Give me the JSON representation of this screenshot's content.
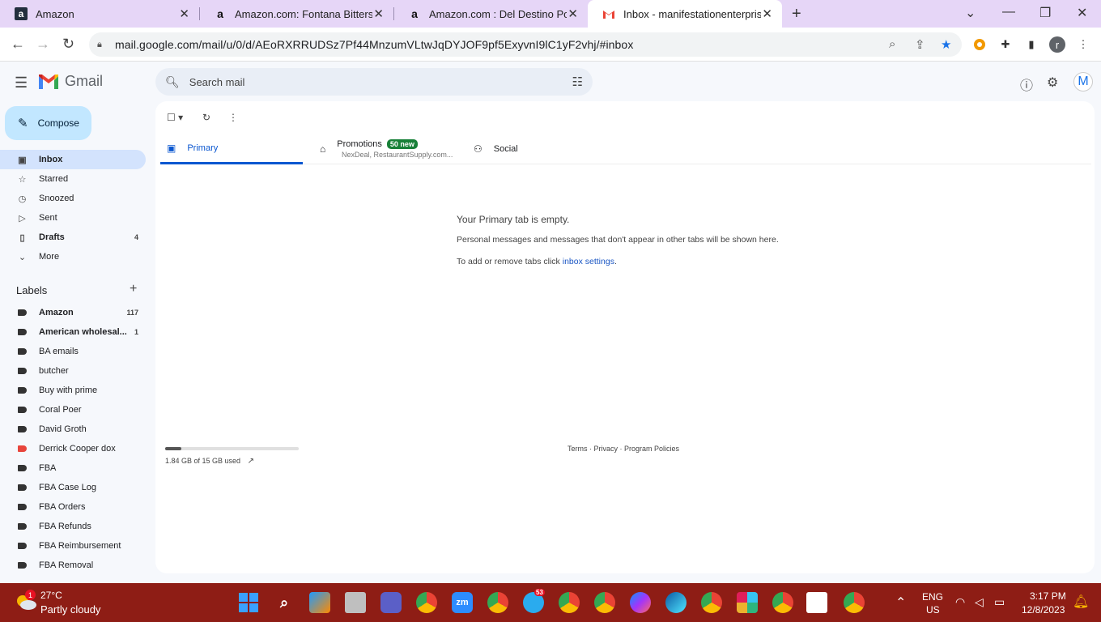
{
  "browser": {
    "tabs": [
      {
        "title": "Amazon"
      },
      {
        "title": "Amazon.com: Fontana Bitterswe"
      },
      {
        "title": "Amazon.com : Del Destino Pomo"
      },
      {
        "title": "Inbox - manifestationenterprises"
      }
    ],
    "url": "mail.google.com/mail/u/0/d/AEoRXRRUDSz7Pf44MnzumVLtwJqDYJOF9pf5ExyvnI9lC1yF2vhj/#inbox",
    "profile_initial": "r"
  },
  "gmail": {
    "app_name": "Gmail",
    "search_placeholder": "Search mail",
    "account_initial": "M",
    "compose_label": "Compose",
    "nav": [
      {
        "label": "Inbox",
        "count": ""
      },
      {
        "label": "Starred",
        "count": ""
      },
      {
        "label": "Snoozed",
        "count": ""
      },
      {
        "label": "Sent",
        "count": ""
      },
      {
        "label": "Drafts",
        "count": "4"
      },
      {
        "label": "More",
        "count": ""
      }
    ],
    "labels_heading": "Labels",
    "labels": [
      {
        "label": "Amazon",
        "count": "117",
        "color": "#333333"
      },
      {
        "label": "American wholesal...",
        "count": "1",
        "color": "#333333"
      },
      {
        "label": "BA emails",
        "count": "",
        "color": "#333333"
      },
      {
        "label": "butcher",
        "count": "",
        "color": "#333333"
      },
      {
        "label": "Buy with prime",
        "count": "",
        "color": "#333333"
      },
      {
        "label": "Coral Poer",
        "count": "",
        "color": "#333333"
      },
      {
        "label": "David Groth",
        "count": "",
        "color": "#333333"
      },
      {
        "label": "Derrick Cooper dox",
        "count": "",
        "color": "#e8453c"
      },
      {
        "label": "FBA",
        "count": "",
        "color": "#333333"
      },
      {
        "label": "FBA Case Log",
        "count": "",
        "color": "#333333"
      },
      {
        "label": "FBA Orders",
        "count": "",
        "color": "#333333"
      },
      {
        "label": "FBA Refunds",
        "count": "",
        "color": "#333333"
      },
      {
        "label": "FBA Reimbursement",
        "count": "",
        "color": "#333333"
      },
      {
        "label": "FBA Removal",
        "count": "",
        "color": "#333333"
      }
    ],
    "tabs": {
      "primary": "Primary",
      "promotions": "Promotions",
      "promotions_badge": "50 new",
      "promotions_sub": "NexDeal, RestaurantSupply.com...",
      "social": "Social"
    },
    "empty": {
      "title": "Your Primary tab is empty.",
      "line1": "Personal messages and messages that don't appear in other tabs will be shown here.",
      "line2_prefix": "To add or remove tabs click ",
      "line2_link": "inbox settings",
      "line2_suffix": "."
    },
    "storage": {
      "text": "1.84 GB of 15 GB used",
      "fraction": 0.123
    },
    "footer": {
      "terms": "Terms",
      "privacy": "Privacy",
      "policies": "Program Policies"
    }
  },
  "taskbar": {
    "weather_temp": "27°C",
    "weather_desc": "Partly cloudy",
    "weather_badge": "1",
    "lang_top": "ENG",
    "lang_bottom": "US",
    "time": "3:17 PM",
    "date": "12/8/2023",
    "telegram_badge": "53"
  }
}
